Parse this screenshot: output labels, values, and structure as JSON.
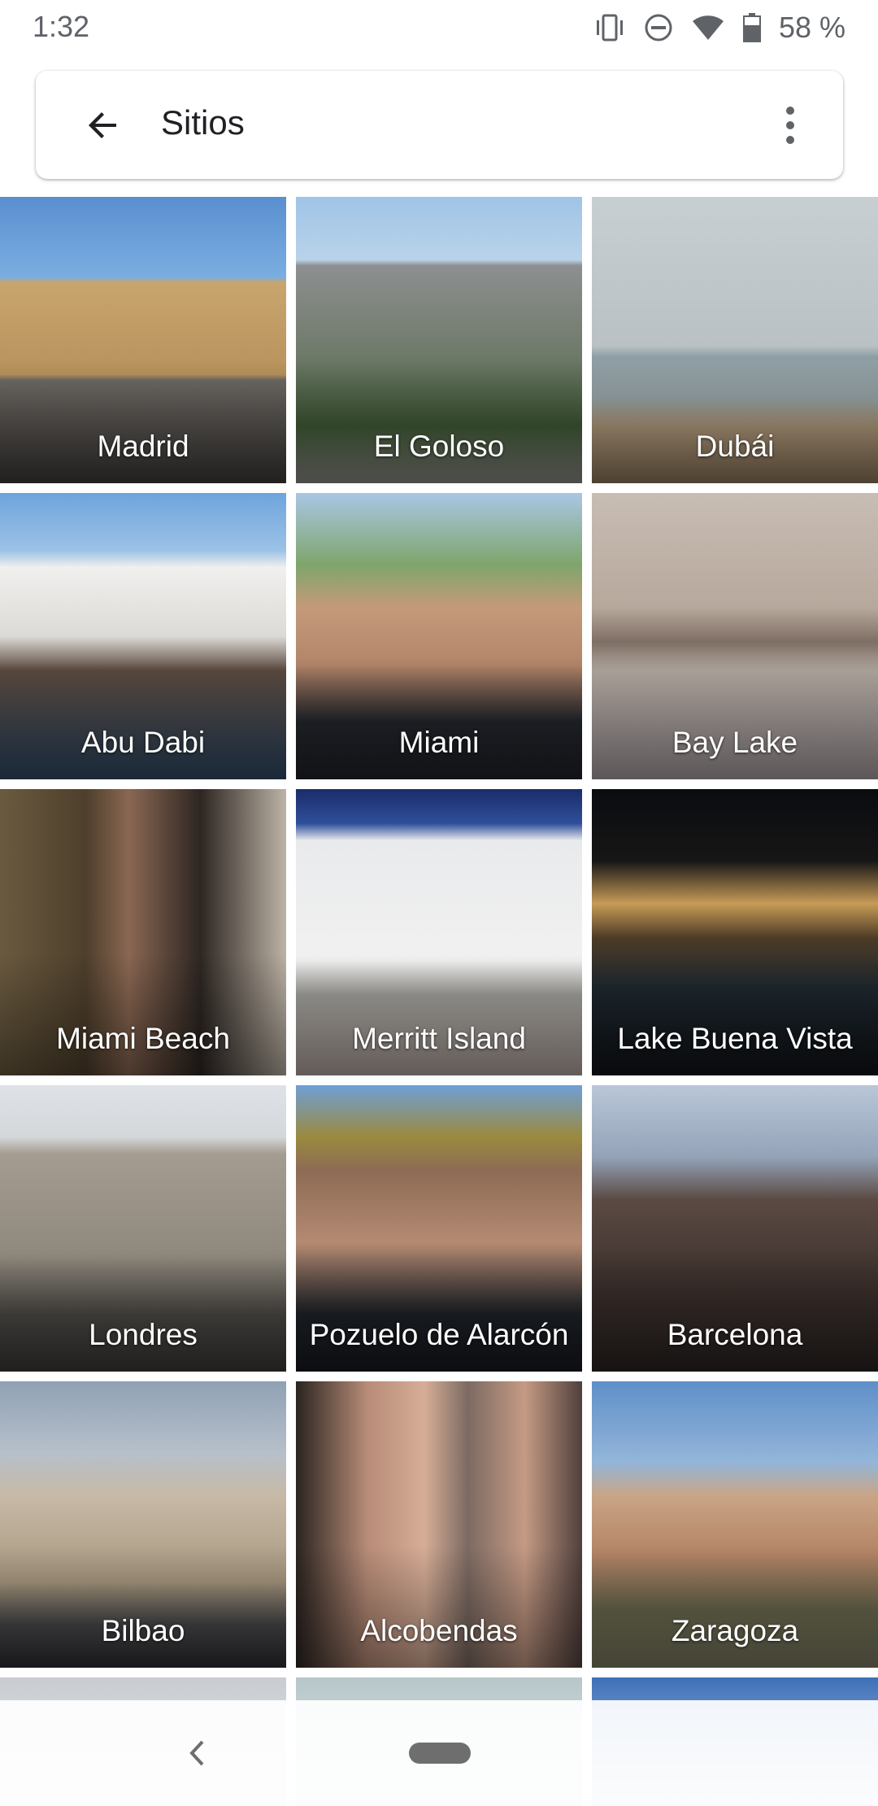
{
  "status": {
    "time": "1:32",
    "battery": "58 %",
    "icons": [
      "vibrate-icon",
      "dnd-icon",
      "wifi-icon",
      "battery-icon"
    ]
  },
  "header": {
    "title": "Sitios",
    "back_icon": "arrow-back-icon",
    "menu_icon": "more-vert-icon"
  },
  "places": [
    {
      "label": "Madrid"
    },
    {
      "label": "El Goloso"
    },
    {
      "label": "Dubái"
    },
    {
      "label": "Abu Dabi"
    },
    {
      "label": "Miami"
    },
    {
      "label": "Bay Lake"
    },
    {
      "label": "Miami Beach"
    },
    {
      "label": "Merritt Island"
    },
    {
      "label": "Lake Buena Vista"
    },
    {
      "label": "Londres"
    },
    {
      "label": "Pozuelo de Alarcón"
    },
    {
      "label": "Barcelona"
    },
    {
      "label": "Bilbao"
    },
    {
      "label": "Alcobendas"
    },
    {
      "label": "Zaragoza"
    }
  ],
  "colors": {
    "accent_text": "#202124",
    "status_text": "#5f6368"
  }
}
